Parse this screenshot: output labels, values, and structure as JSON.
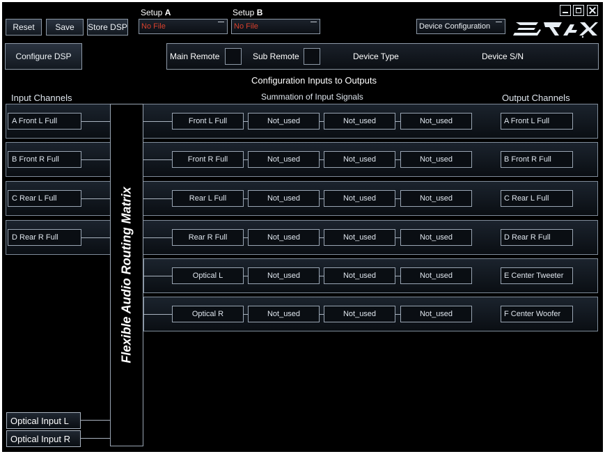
{
  "toolbar": {
    "reset": "Reset",
    "save": "Save",
    "store_dsp": "Store DSP",
    "configure_dsp": "Configure DSP",
    "device_configuration": "Device Configuration"
  },
  "setup_a": {
    "prefix": "Setup ",
    "letter": "A",
    "value": "No File"
  },
  "setup_b": {
    "prefix": "Setup ",
    "letter": "B",
    "value": "No File"
  },
  "window_controls": {
    "minimize": "minimize-icon",
    "maximize": "maximize-icon",
    "close": "close-icon"
  },
  "logo": {
    "text": "3RX",
    "icon": "brax-logo"
  },
  "device_info": {
    "main_remote": "Main Remote",
    "sub_remote": "Sub Remote",
    "device_type": "Device Type",
    "device_sn": "Device S/N"
  },
  "headings": {
    "config_title": "Configuration Inputs to Outputs",
    "input_channels": "Input Channels",
    "summation": "Summation of Input Signals",
    "output_channels": "Output Channels"
  },
  "matrix_label": "Flexible Audio Routing Matrix",
  "rows": [
    {
      "input": "A   Front L Full",
      "sum": [
        "Front L Full",
        "Not_used",
        "Not_used",
        "Not_used"
      ],
      "output": "A    Front L Full"
    },
    {
      "input": "B   Front R Full",
      "sum": [
        "Front R Full",
        "Not_used",
        "Not_used",
        "Not_used"
      ],
      "output": "B    Front R Full"
    },
    {
      "input": "C   Rear L Full",
      "sum": [
        "Rear L Full",
        "Not_used",
        "Not_used",
        "Not_used"
      ],
      "output": "C   Rear L Full"
    },
    {
      "input": "D   Rear R Full",
      "sum": [
        "Rear R Full",
        "Not_used",
        "Not_used",
        "Not_used"
      ],
      "output": "D    Rear R Full"
    },
    {
      "sum": [
        "Optical L",
        "Not_used",
        "Not_used",
        "Not_used"
      ],
      "output": "E   Center Tweeter"
    },
    {
      "sum": [
        "Optical R",
        "Not_used",
        "Not_used",
        "Not_used"
      ],
      "output": "F   Center Woofer"
    }
  ],
  "optical_inputs": [
    "Optical Input L",
    "Optical Input R"
  ]
}
